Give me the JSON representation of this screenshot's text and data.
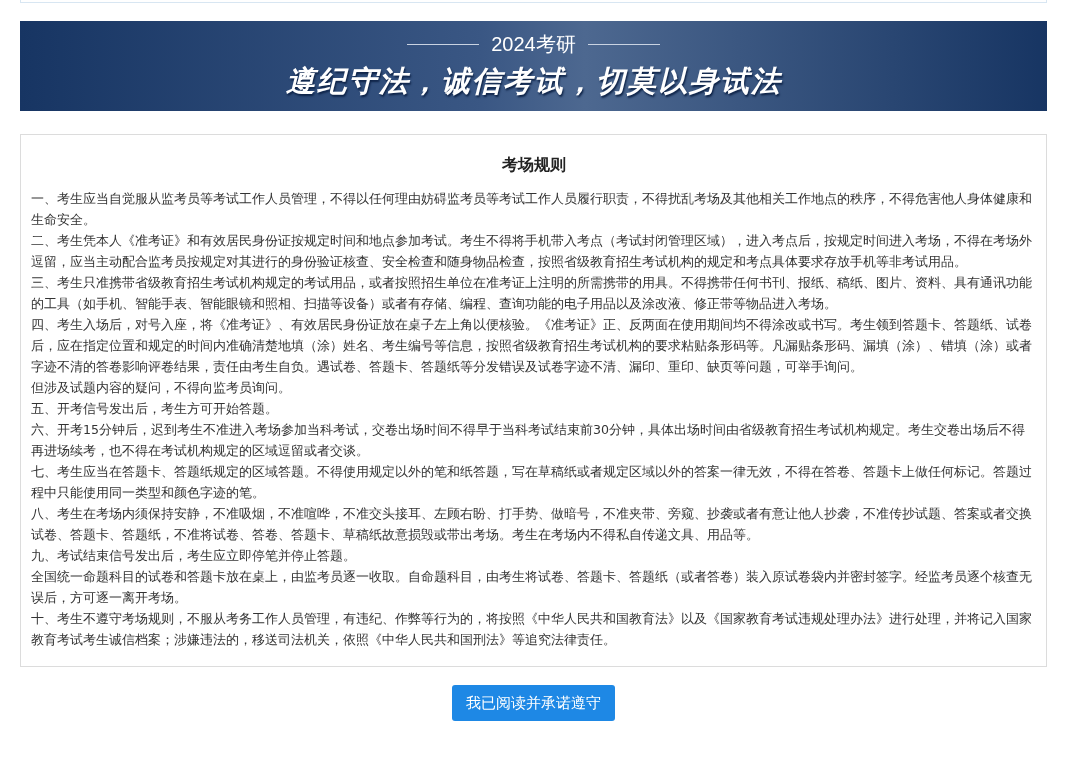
{
  "banner": {
    "subtitle": "2024考研",
    "slogan": "遵纪守法，诚信考试，切莫以身试法"
  },
  "rules_card": {
    "title": "考场规则",
    "paragraphs": [
      "一、考生应当自觉服从监考员等考试工作人员管理，不得以任何理由妨碍监考员等考试工作人员履行职责，不得扰乱考场及其他相关工作地点的秩序，不得危害他人身体健康和生命安全。",
      "二、考生凭本人《准考证》和有效居民身份证按规定时间和地点参加考试。考生不得将手机带入考点（考试封闭管理区域），进入考点后，按规定时间进入考场，不得在考场外逗留，应当主动配合监考员按规定对其进行的身份验证核查、安全检查和随身物品检查，按照省级教育招生考试机构的规定和考点具体要求存放手机等非考试用品。",
      "三、考生只准携带省级教育招生考试机构规定的考试用品，或者按照招生单位在准考证上注明的所需携带的用具。不得携带任何书刊、报纸、稿纸、图片、资料、具有通讯功能的工具（如手机、智能手表、智能眼镜和照相、扫描等设备）或者有存储、编程、查询功能的电子用品以及涂改液、修正带等物品进入考场。",
      "四、考生入场后，对号入座，将《准考证》、有效居民身份证放在桌子左上角以便核验。《准考证》正、反两面在使用期间均不得涂改或书写。考生领到答题卡、答题纸、试卷后，应在指定位置和规定的时间内准确清楚地填（涂）姓名、考生编号等信息，按照省级教育招生考试机构的要求粘贴条形码等。凡漏贴条形码、漏填（涂）、错填（涂）或者字迹不清的答卷影响评卷结果，责任由考生自负。遇试卷、答题卡、答题纸等分发错误及试卷字迹不清、漏印、重印、缺页等问题，可举手询问。",
      "但涉及试题内容的疑问，不得向监考员询问。",
      "五、开考信号发出后，考生方可开始答题。",
      "六、开考15分钟后，迟到考生不准进入考场参加当科考试，交卷出场时间不得早于当科考试结束前30分钟，具体出场时间由省级教育招生考试机构规定。考生交卷出场后不得再进场续考，也不得在考试机构规定的区域逗留或者交谈。",
      "七、考生应当在答题卡、答题纸规定的区域答题。不得使用规定以外的笔和纸答题，写在草稿纸或者规定区域以外的答案一律无效，不得在答卷、答题卡上做任何标记。答题过程中只能使用同一类型和颜色字迹的笔。",
      "八、考生在考场内须保持安静，不准吸烟，不准喧哗，不准交头接耳、左顾右盼、打手势、做暗号，不准夹带、旁窥、抄袭或者有意让他人抄袭，不准传抄试题、答案或者交换试卷、答题卡、答题纸，不准将试卷、答卷、答题卡、草稿纸故意损毁或带出考场。考生在考场内不得私自传递文具、用品等。",
      "九、考试结束信号发出后，考生应立即停笔并停止答题。",
      "全国统一命题科目的试卷和答题卡放在桌上，由监考员逐一收取。自命题科目，由考生将试卷、答题卡、答题纸（或者答卷）装入原试卷袋内并密封签字。经监考员逐个核查无误后，方可逐一离开考场。",
      "十、考生不遵守考场规则，不服从考务工作人员管理，有违纪、作弊等行为的，将按照《中华人民共和国教育法》以及《国家教育考试违规处理办法》进行处理，并将记入国家教育考试考生诚信档案；涉嫌违法的，移送司法机关，依照《中华人民共和国刑法》等追究法律责任。"
    ]
  },
  "agree_button": "我已阅读并承诺遵守"
}
